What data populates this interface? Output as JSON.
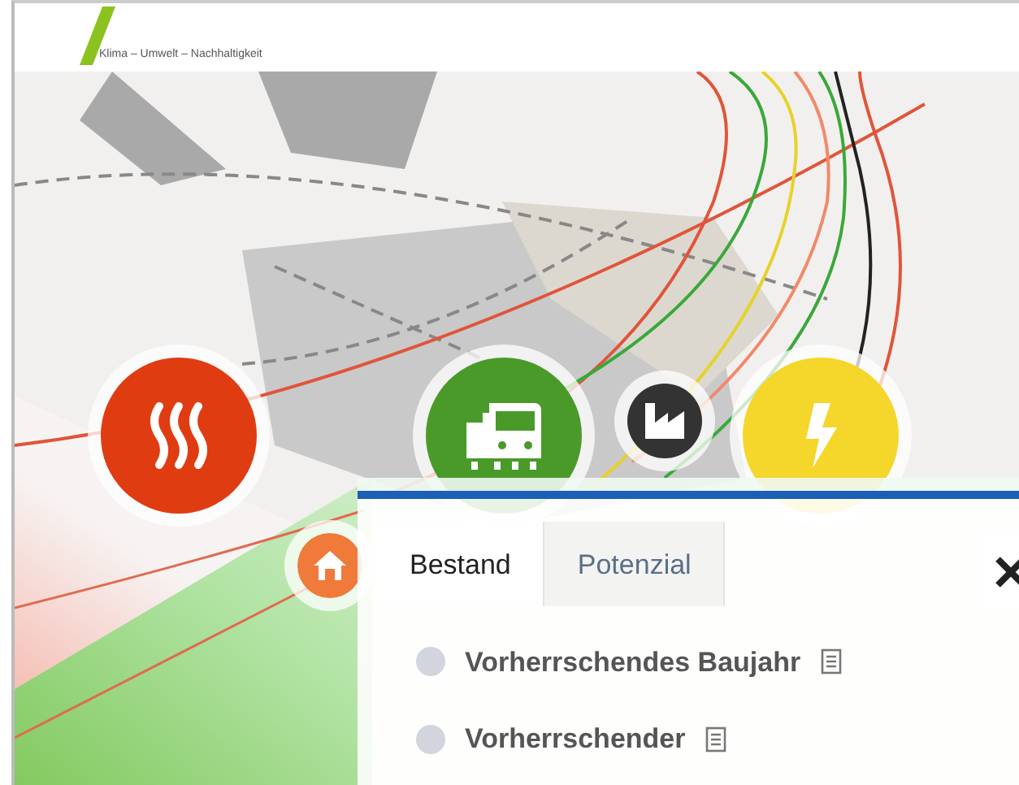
{
  "header": {
    "tagline": "Klima – Umwelt – Nachhaltigkeit"
  },
  "map_icons": [
    {
      "kind": "heat",
      "color": "#e03c12"
    },
    {
      "kind": "transport",
      "color": "#4a9a2a"
    },
    {
      "kind": "industry",
      "color": "#333333"
    },
    {
      "kind": "power",
      "color": "#f5d62a"
    },
    {
      "kind": "home",
      "color": "#f07a3a"
    }
  ],
  "panel": {
    "tabs": [
      {
        "label": "Bestand",
        "selected": true
      },
      {
        "label": "Potenzial",
        "selected": false
      }
    ],
    "layers": [
      {
        "label": "Vorherrschendes Baujahr",
        "checked": false
      },
      {
        "label": "Vorherrschender",
        "checked": false
      }
    ]
  }
}
